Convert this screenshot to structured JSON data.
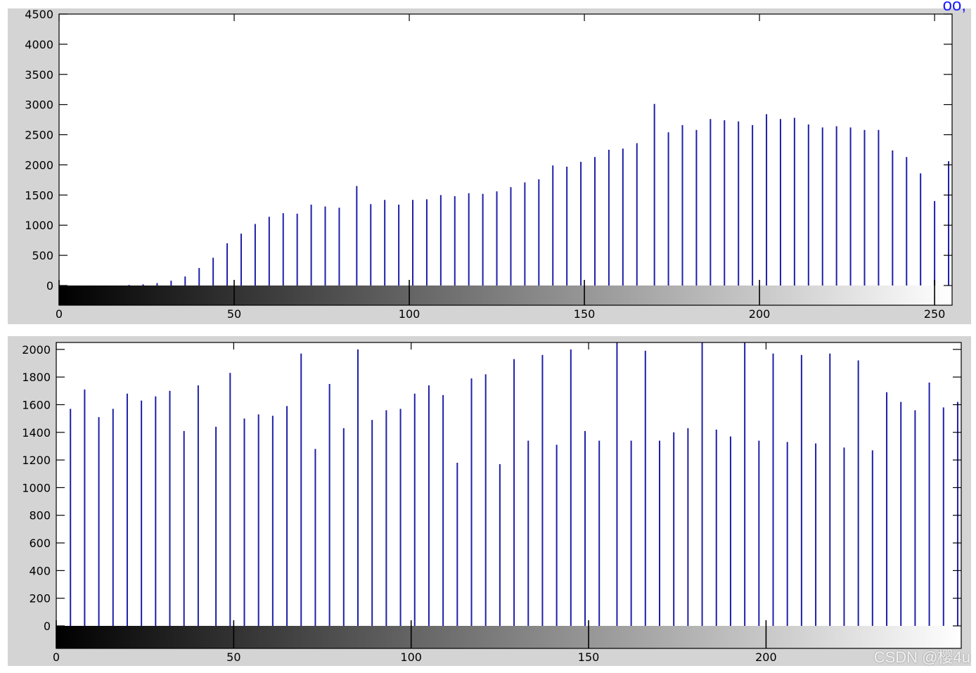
{
  "corner_text": "oo,",
  "watermark": "CSDN @樱4u",
  "chart_data": [
    {
      "type": "bar",
      "xlim": [
        0,
        255
      ],
      "ylim": [
        0,
        4500
      ],
      "xticks": [
        0,
        50,
        100,
        150,
        200,
        250
      ],
      "yticks": [
        0,
        500,
        1000,
        1500,
        2000,
        2500,
        3000,
        3500,
        4000,
        4500
      ],
      "colorbar": "grayscale",
      "x": [
        20,
        24,
        28,
        32,
        36,
        40,
        44,
        48,
        52,
        56,
        60,
        64,
        68,
        72,
        76,
        80,
        85,
        89,
        93,
        97,
        101,
        105,
        109,
        113,
        117,
        121,
        125,
        129,
        133,
        137,
        141,
        145,
        149,
        153,
        157,
        161,
        165,
        170,
        174,
        178,
        182,
        186,
        190,
        194,
        198,
        202,
        206,
        210,
        214,
        218,
        222,
        226,
        230,
        234,
        238,
        242,
        246,
        250,
        254
      ],
      "values": [
        10,
        20,
        40,
        80,
        150,
        290,
        460,
        700,
        860,
        1020,
        1140,
        1200,
        1190,
        1340,
        1310,
        1290,
        1650,
        1350,
        1420,
        1340,
        1420,
        1430,
        1500,
        1480,
        1530,
        1520,
        1560,
        1630,
        1710,
        1760,
        1990,
        1970,
        2050,
        2130,
        2250,
        2270,
        2360,
        3010,
        2540,
        2660,
        2580,
        2760,
        2740,
        2720,
        2660,
        2840,
        2760,
        2780,
        2670,
        2620,
        2640,
        2620,
        2580,
        2580,
        2240,
        2130,
        1860,
        1400,
        2060
      ]
    },
    {
      "type": "bar",
      "xlim": [
        0,
        255
      ],
      "ylim": [
        0,
        2050
      ],
      "xticks": [
        0,
        50,
        100,
        150,
        200
      ],
      "yticks": [
        0,
        200,
        400,
        600,
        800,
        1000,
        1200,
        1400,
        1600,
        1800,
        2000
      ],
      "colorbar": "grayscale",
      "x": [
        4,
        8,
        12,
        16,
        20,
        24,
        28,
        32,
        36,
        40,
        45,
        49,
        53,
        57,
        61,
        65,
        69,
        73,
        77,
        81,
        85,
        89,
        93,
        97,
        101,
        105,
        109,
        113,
        117,
        121,
        125,
        129,
        133,
        137,
        141,
        145,
        149,
        153,
        158,
        162,
        166,
        170,
        174,
        178,
        182,
        186,
        190,
        194,
        198,
        202,
        206,
        210,
        214,
        218,
        222,
        226,
        230,
        234,
        238,
        242,
        246,
        250,
        254
      ],
      "values": [
        1570,
        1710,
        1510,
        1570,
        1680,
        1630,
        1660,
        1700,
        1410,
        1740,
        1440,
        1830,
        1500,
        1530,
        1520,
        1590,
        1970,
        1280,
        1750,
        1430,
        2000,
        1490,
        1560,
        1570,
        1680,
        1740,
        1670,
        1180,
        1790,
        1820,
        1170,
        1930,
        1340,
        1960,
        1310,
        2000,
        1410,
        1340,
        2050,
        1340,
        1990,
        1340,
        1400,
        1430,
        2050,
        1420,
        1370,
        2050,
        1340,
        1970,
        1330,
        1960,
        1320,
        1970,
        1290,
        1920,
        1270,
        1690,
        1620,
        1560,
        1760,
        1580,
        1620
      ]
    }
  ]
}
